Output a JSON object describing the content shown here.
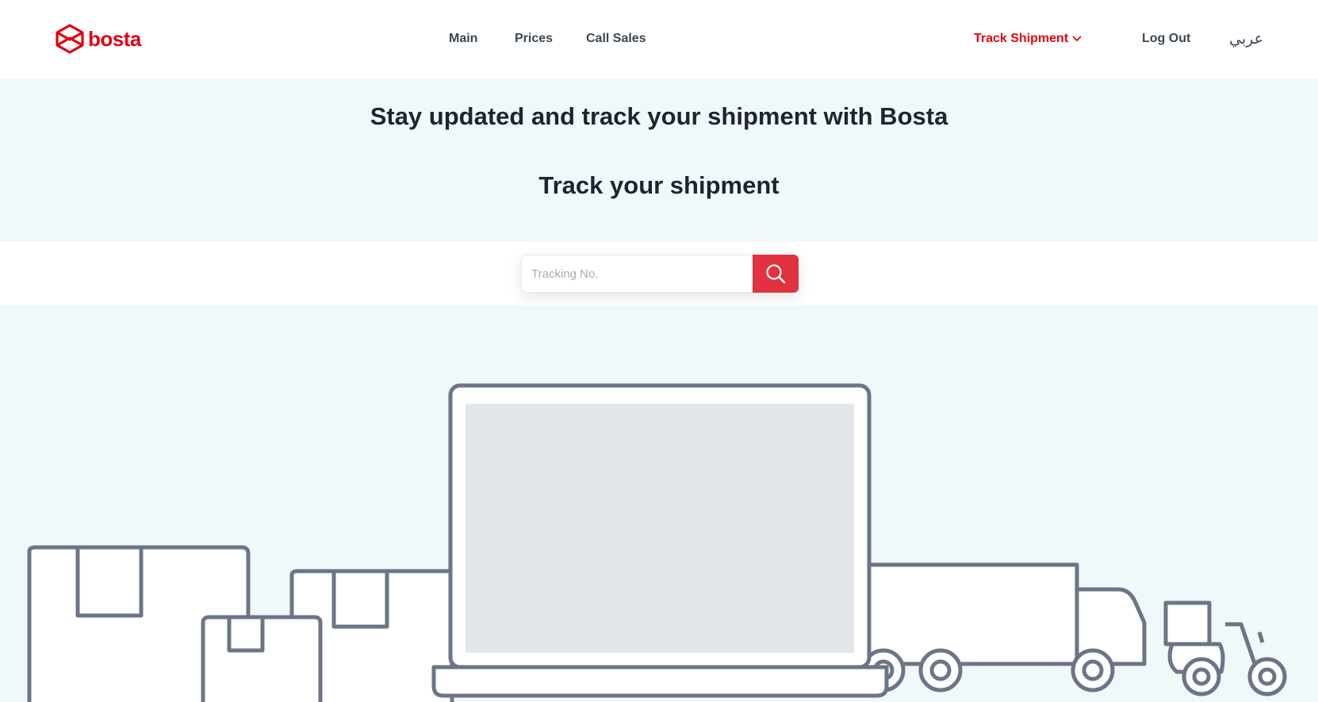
{
  "header": {
    "logo_text": "bosta",
    "nav": {
      "main": "Main",
      "prices": "Prices",
      "call_sales": "Call Sales"
    },
    "track_shipment": "Track Shipment",
    "log_out": "Log Out",
    "language": "عربي"
  },
  "hero": {
    "title": "Stay updated and track your shipment with Bosta",
    "subtitle": "Track your shipment"
  },
  "search": {
    "placeholder": "Tracking No."
  },
  "colors": {
    "brand_red": "#e3000f",
    "button_red": "#e2313f",
    "hero_bg": "#f0f8fa",
    "outline_gray": "#6b7587"
  }
}
